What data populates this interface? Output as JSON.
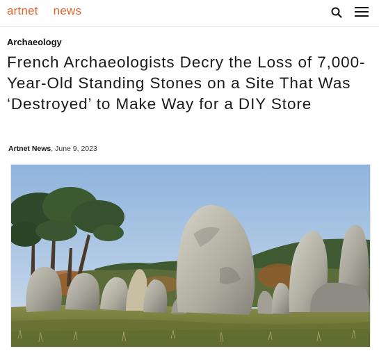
{
  "header": {
    "logo_word1": "artnet",
    "logo_word2": "news",
    "brand_color": "#e2662e",
    "search_icon": "search-icon",
    "menu_icon": "hamburger-menu-icon"
  },
  "article": {
    "category": "Archaeology",
    "title": "French Archaeologists Decry the Loss of 7,000-Year-Old Standing Stones on a Site That Was ‘Destroyed’ to Make Way for a DIY Store",
    "author": "Artnet News",
    "date": ", June 9, 2023"
  }
}
